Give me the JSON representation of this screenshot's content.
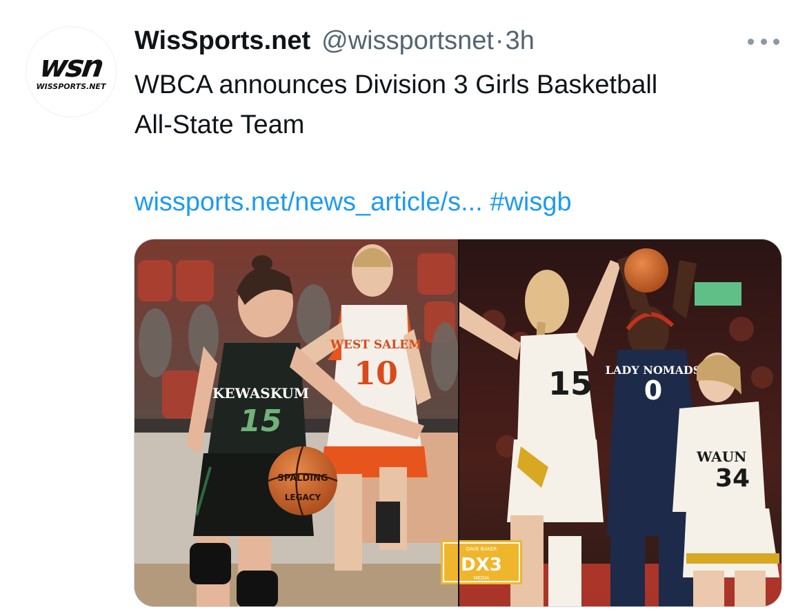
{
  "tweet": {
    "avatar": {
      "logo_text": "wsn",
      "sub_text": "WISSPORTS.NET"
    },
    "author": {
      "display_name": "WisSports.net",
      "handle": "@wissportsnet",
      "separator": "·",
      "time": "3h"
    },
    "more_icon": "more-horizontal-icon",
    "text_line1": "WBCA announces Division 3 Girls Basketball",
    "text_line2": "All-State Team",
    "link_url": "wissports.net/news_article/s...",
    "hashtag": "#wisgb",
    "media": {
      "left_photo": {
        "front_jersey_name": "KEWASKUM",
        "front_jersey_number": "15",
        "back_jersey_name": "WEST SALEM",
        "back_jersey_number": "10",
        "ball_brand": "SPALDING",
        "ball_model": "LEGACY"
      },
      "right_photo": {
        "shooter_jersey_name": "LADY NOMADS",
        "shooter_jersey_number": "0",
        "defender_jersey_number": "15",
        "third_jersey_name": "WAUN",
        "third_jersey_number": "34"
      },
      "watermark_top": "DAVE BAKER",
      "watermark_logo": "DX3",
      "watermark_bottom": "MEDIA"
    },
    "colors": {
      "link": "#1d9bf0",
      "secondary_text": "#536471",
      "kewaskum_green": "#1a1f1c",
      "west_salem_orange": "#e8551c",
      "nomads_navy": "#1d2a4a",
      "waunakee_gold": "#d8a823",
      "watermark_gold": "#f0b62b"
    }
  }
}
